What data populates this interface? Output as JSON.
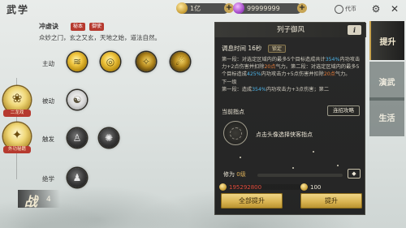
{
  "header": {
    "title": "武学",
    "gold": "1亿",
    "gems": "99999999",
    "quest_label": "代币"
  },
  "skill": {
    "name": "冲虚诀",
    "tags": [
      "秘本",
      "御使"
    ],
    "description": "众妙之门，玄之又玄，天地之始，道法自然。"
  },
  "rows": {
    "active": "主动",
    "passive": "被动",
    "trigger": "触发",
    "ultimate": "绝学"
  },
  "side_badges": [
    {
      "label": "二龙戏"
    },
    {
      "label": "外功秘籍"
    }
  ],
  "battle": {
    "char": "战",
    "value": "4"
  },
  "panel": {
    "title": "列子御风",
    "adjust_label": "调息时间",
    "adjust_value": "16秒",
    "lock_label": "锁定",
    "desc_parts": {
      "p1": "第一段：对选定区域内的最多",
      "p1n": "5",
      "p1b": "个目标造成共计",
      "p1c": "354%",
      "p1d": "内功攻击力+2点伤害并扣除",
      "p1e": "20点",
      "p1f": "气力。第二段：对选定区域内的最多",
      "p1g": "5",
      "p1h": "个目标造成",
      "p1i": "425%",
      "p1j": "内功攻击力+5点伤害并扣除",
      "p1k": "20点",
      "p1l": "气力。",
      "next_label": "下一级",
      "p2": "第一段：造成",
      "p2b": "354%",
      "p2c": "内功攻击力+3点伤害；第二"
    },
    "current_point_label": "当前指点",
    "strategy_label": "连招攻略",
    "point_hint": "点击头像选择侠客指点",
    "cultivation_label": "修为",
    "cultivation_value": "0级",
    "cultivation_progress": 0,
    "up_arrow_label": "◆",
    "cost_gold": "195292800",
    "cost_other": "100",
    "btn_all": "全部提升",
    "btn_up": "提升"
  },
  "tabs": [
    {
      "label": "提升",
      "active": true
    },
    {
      "label": "演武",
      "active": false
    },
    {
      "label": "生活",
      "active": false
    }
  ]
}
